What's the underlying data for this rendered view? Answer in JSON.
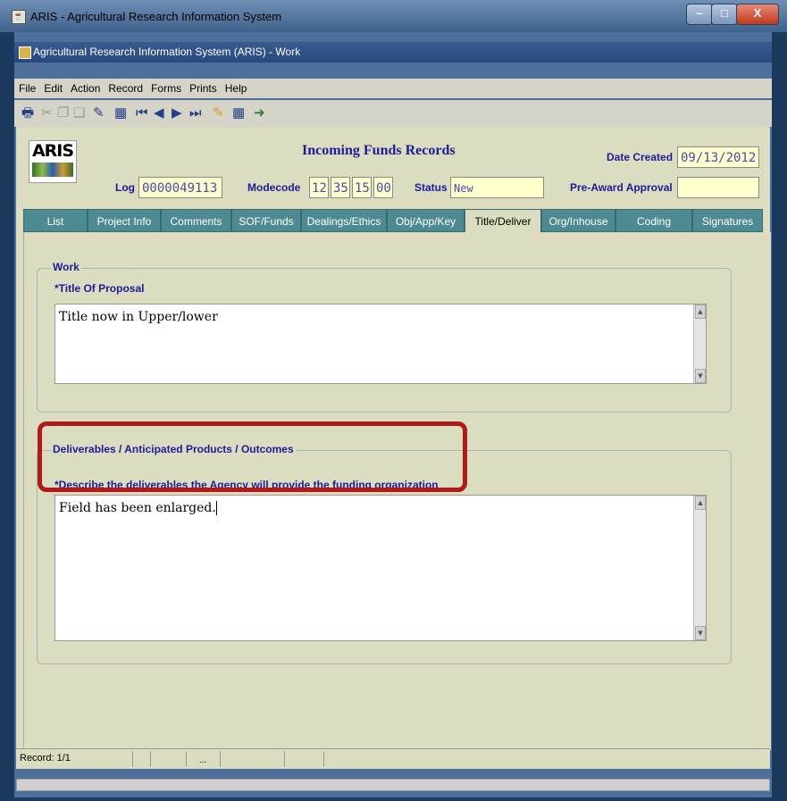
{
  "window": {
    "outer_title": "ARIS - Agricultural Research Information System",
    "inner_title": "Agricultural Research Information System (ARIS) - Work"
  },
  "menu": [
    "File",
    "Edit",
    "Action",
    "Record",
    "Forms",
    "Prints",
    "Help"
  ],
  "header": {
    "logo_text": "ARIS",
    "form_title": "Incoming Funds Records",
    "date_created_label": "Date Created",
    "date_created_value": "09/13/2012",
    "log_label": "Log",
    "log_value": "0000049113",
    "modecode_label": "Modecode",
    "modecode_values": [
      "12",
      "35",
      "15",
      "00"
    ],
    "status_label": "Status",
    "status_value": "New",
    "preaward_label": "Pre-Award Approval",
    "preaward_value": ""
  },
  "tabs": [
    "List",
    "Project Info",
    "Comments",
    "SOF/Funds",
    "Dealings/Ethics",
    "Obj/App/Key",
    "Title/Deliver",
    "Org/Inhouse",
    "Coding",
    "Signatures"
  ],
  "work": {
    "group_label": "Work",
    "title_label": "*Title Of Proposal",
    "title_value": "Title now in Upper/lower"
  },
  "deliverables": {
    "group_label": "Deliverables / Anticipated Products / Outcomes",
    "describe_label": "*Describe the deliverables the Agency will provide the funding organization",
    "value": "Field has been enlarged."
  },
  "status": {
    "record": "Record: 1/1",
    "ellipsis": "..."
  }
}
